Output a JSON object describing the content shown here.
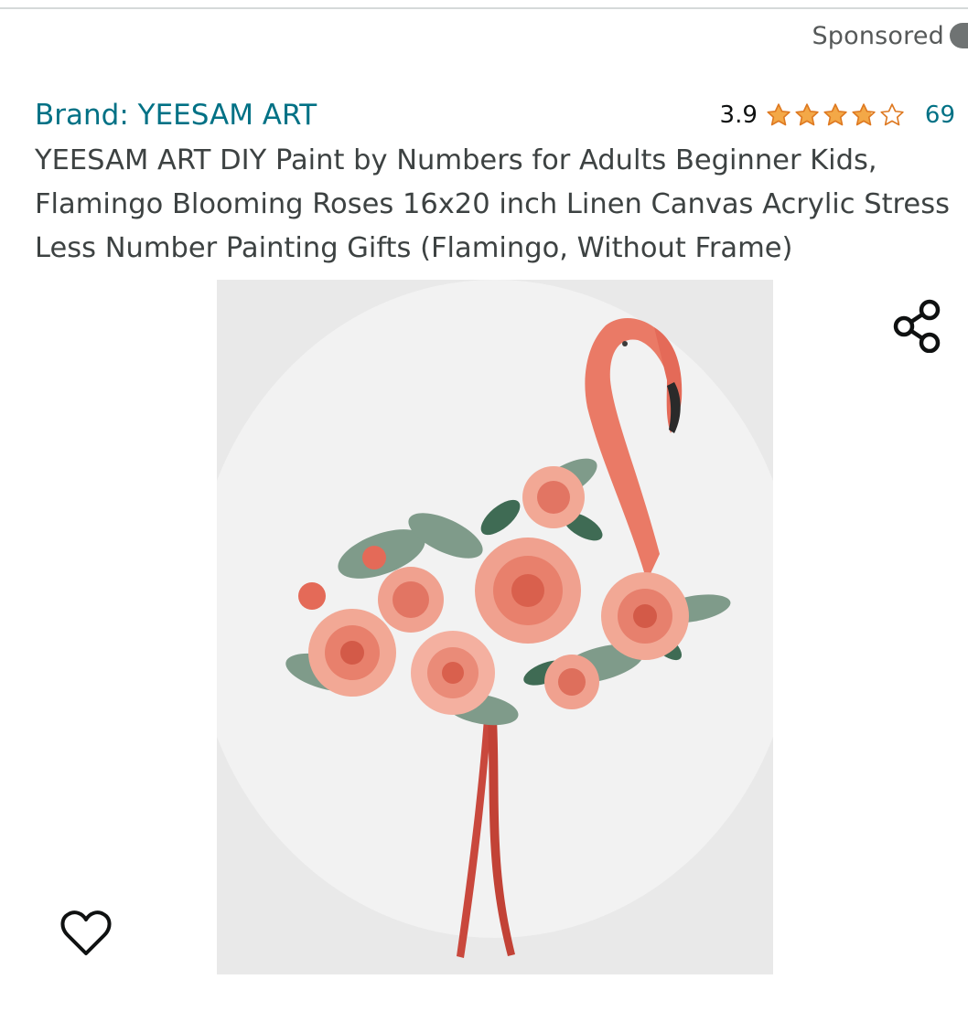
{
  "ad": {
    "sponsored_label": "Sponsored"
  },
  "product": {
    "brand_label": "Brand: YEESAM ART",
    "rating_value": "3.9",
    "rating_fraction": 0.78,
    "review_count": "69",
    "title": "YEESAM ART DIY Paint by Numbers for Adults Beginner Kids, Flamingo Blooming Roses 16x20 inch Linen Canvas Acrylic Stress Less Number Painting Gifts (Flamingo, Without Frame)"
  },
  "icons": {
    "share": "share-icon",
    "wishlist": "heart-icon",
    "info": "info-icon",
    "star": "star-icon"
  },
  "colors": {
    "brand_link": "#007185",
    "star_fill": "#f3a847",
    "star_outline": "#de7921",
    "text_secondary": "#565959"
  }
}
